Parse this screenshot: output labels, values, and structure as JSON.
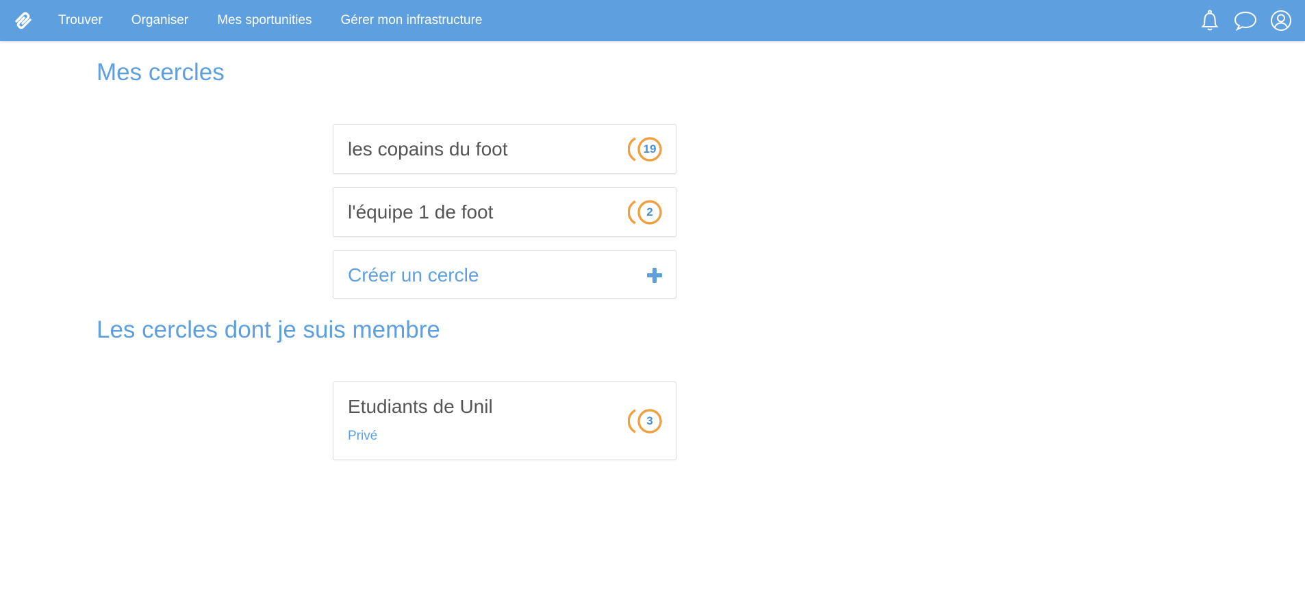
{
  "nav": {
    "items": [
      {
        "label": "Trouver"
      },
      {
        "label": "Organiser"
      },
      {
        "label": "Mes sportunities"
      },
      {
        "label": "Gérer mon infrastructure"
      }
    ],
    "icons": [
      "logo-icon",
      "bell-icon",
      "chat-icon",
      "user-icon"
    ]
  },
  "sections": {
    "mine_title": "Mes cercles",
    "member_title": "Les cercles dont je suis membre"
  },
  "my_circles": [
    {
      "name": "les copains du foot",
      "count": "19"
    },
    {
      "name": "l'équipe 1 de foot",
      "count": "2"
    }
  ],
  "create_circle": {
    "label": "Créer un cercle",
    "icon": "plus-icon"
  },
  "member_circles": [
    {
      "name": "Etudiants de Unil",
      "visibility": "Privé",
      "count": "3"
    }
  ],
  "colors": {
    "primary": "#5e9fe0",
    "accent": "#f0a040",
    "text": "#555555"
  }
}
